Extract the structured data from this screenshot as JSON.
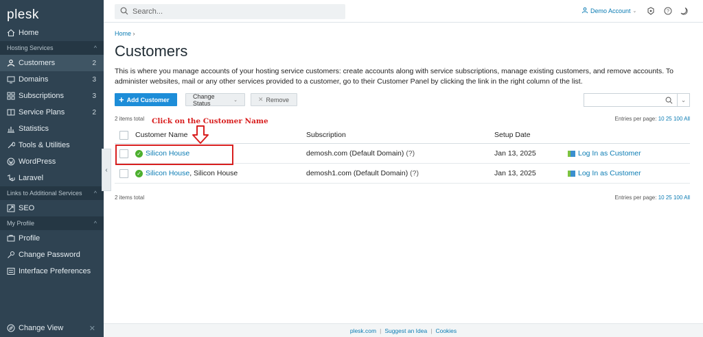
{
  "app": {
    "logo": "plesk"
  },
  "sidebar": {
    "home": "Home",
    "sections": [
      {
        "title": "Hosting Services"
      },
      {
        "title": "Links to Additional Services"
      },
      {
        "title": "My Profile"
      }
    ],
    "hosting_items": [
      {
        "label": "Customers",
        "count": "2",
        "icon": "user-icon"
      },
      {
        "label": "Domains",
        "count": "3",
        "icon": "monitor-icon"
      },
      {
        "label": "Subscriptions",
        "count": "3",
        "icon": "grid-icon"
      },
      {
        "label": "Service Plans",
        "count": "2",
        "icon": "book-icon"
      },
      {
        "label": "Statistics",
        "count": "",
        "icon": "bar-chart-icon"
      },
      {
        "label": "Tools & Utilities",
        "count": "",
        "icon": "tools-icon"
      },
      {
        "label": "WordPress",
        "count": "",
        "icon": "wordpress-icon"
      },
      {
        "label": "Laravel",
        "count": "",
        "icon": "laravel-icon"
      }
    ],
    "links_items": [
      {
        "label": "SEO",
        "icon": "seo-icon"
      }
    ],
    "profile_items": [
      {
        "label": "Profile",
        "icon": "id-card-icon"
      },
      {
        "label": "Change Password",
        "icon": "key-icon"
      },
      {
        "label": "Interface Preferences",
        "icon": "preferences-icon"
      }
    ],
    "footer": "Change View"
  },
  "topbar": {
    "search_placeholder": "Search...",
    "account": "Demo Account"
  },
  "page": {
    "breadcrumb": "Home",
    "title": "Customers",
    "intro": "This is where you manage accounts of your hosting service customers: create accounts along with service subscriptions, manage existing customers, and remove accounts. To administer websites, mail or any other services provided to a customer, go to their Customer Panel by clicking the link in the right column of the list."
  },
  "toolbar": {
    "add": "Add Customer",
    "change_status": "Change Status",
    "remove": "Remove"
  },
  "list": {
    "total": "2 items total",
    "entries_label": "Entries per page:",
    "entries_options": [
      "10",
      "25",
      "100",
      "All"
    ],
    "columns": {
      "name": "Customer Name",
      "subscription": "Subscription",
      "date": "Setup Date"
    },
    "rows": [
      {
        "name": "Silicon House",
        "company": "",
        "subscription": "demosh.com (Default Domain)",
        "hint": "(?)",
        "date": "Jan 13, 2025",
        "action": "Log In as Customer"
      },
      {
        "name": "Silicon House",
        "company": ", Silicon House",
        "subscription": "demosh1.com (Default Domain)",
        "hint": "(?)",
        "date": "Jan 13, 2025",
        "action": "Log In as Customer"
      }
    ]
  },
  "annotation": {
    "text": "Click on the Customer Name",
    "color": "#d81e1e"
  },
  "footer": {
    "links": [
      "plesk.com",
      "Suggest an Idea",
      "Cookies"
    ]
  }
}
